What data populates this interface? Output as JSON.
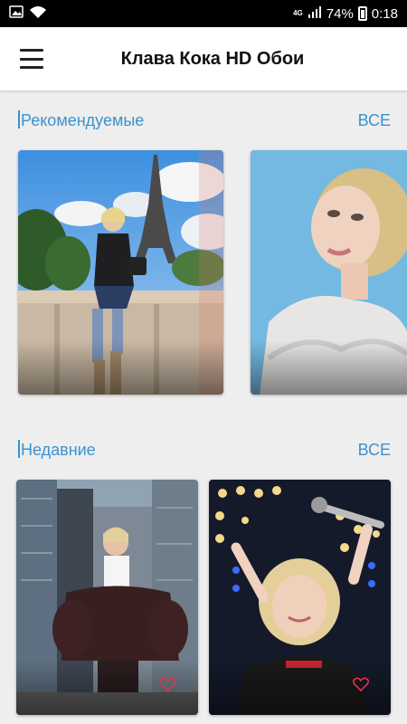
{
  "status_bar": {
    "network": "4G",
    "battery": "74%",
    "time": "0:18"
  },
  "app_bar": {
    "title": "Клава Кока HD Обои"
  },
  "recommended": {
    "title": "Рекомендуемые",
    "all_label": "ВСЕ"
  },
  "recent": {
    "title": "Недавние",
    "all_label": "ВСЕ"
  },
  "colors": {
    "accent": "#3a92d0",
    "app_bar_bg": "#ffffff",
    "screen_bg": "#eeeeee",
    "heart": "#e2334a"
  }
}
